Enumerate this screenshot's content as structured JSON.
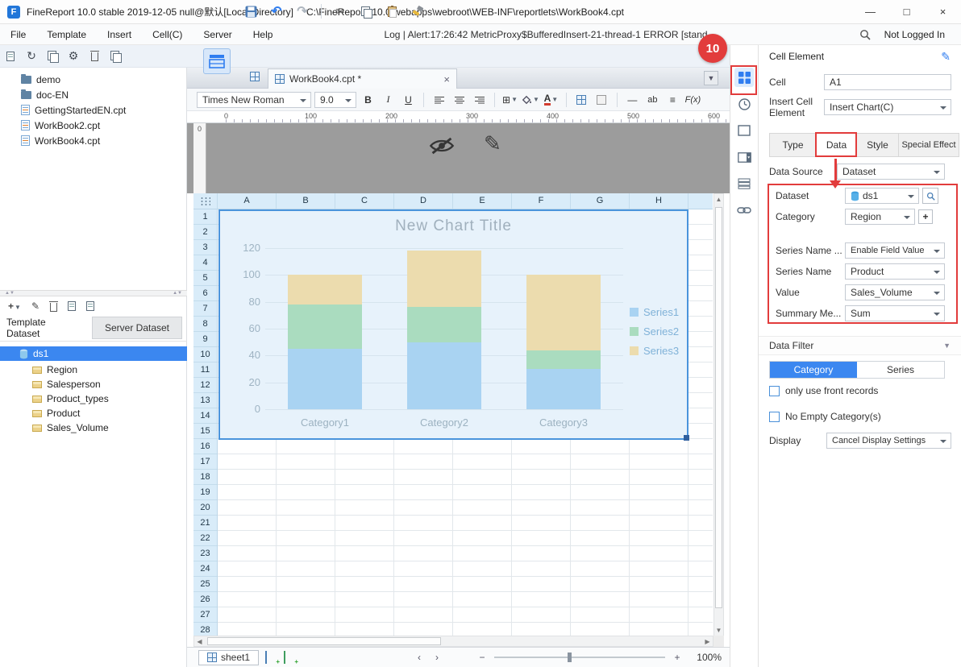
{
  "titlebar": {
    "app_title": "FineReport 10.0 stable 2019-12-05 null@默认[Local Directory]",
    "file_path": "C:\\FineReport_10.0\\webapps\\webroot\\WEB-INF\\reportlets\\WorkBook4.cpt",
    "minimize": "—",
    "maximize": "□",
    "close": "×"
  },
  "menubar": {
    "items": [
      "File",
      "Template",
      "Insert",
      "Cell(C)",
      "Server",
      "Help"
    ],
    "log_text": "Log | Alert:17:26:42 MetricProxy$BufferedInsert-21-thread-1 ERROR [stand",
    "login_label": "Not Logged In"
  },
  "annotations": {
    "badge": "10"
  },
  "sidebar": {
    "folders": [
      "demo",
      "doc-EN"
    ],
    "files": [
      "GettingStartedEN.cpt",
      "WorkBook2.cpt",
      "WorkBook4.cpt"
    ],
    "dataset_tabs": {
      "template": "Template Dataset",
      "server": "Server Dataset"
    },
    "dataset_name": "ds1",
    "fields": [
      "Region",
      "Salesperson",
      "Product_types",
      "Product",
      "Sales_Volume"
    ]
  },
  "document": {
    "tab_label": "WorkBook4.cpt *",
    "font_name": "Times New Roman",
    "font_size": "9.0",
    "bold": "B",
    "italic": "I",
    "underline": "U",
    "fx_label": "F(x)",
    "ab_label": "ab",
    "ruler_marks": [
      "0",
      "100",
      "200",
      "300",
      "400",
      "500",
      "600"
    ],
    "vruler_mark": "0",
    "columns": [
      "A",
      "B",
      "C",
      "D",
      "E",
      "F",
      "G",
      "H"
    ],
    "rows": [
      "1",
      "2",
      "3",
      "4",
      "5",
      "6",
      "7",
      "8",
      "9",
      "10",
      "11",
      "12",
      "13",
      "14",
      "15",
      "16",
      "17",
      "18",
      "19",
      "20",
      "21",
      "22",
      "23",
      "24",
      "25",
      "26",
      "27",
      "28"
    ]
  },
  "chart_data": {
    "type": "bar",
    "stacked": true,
    "title": "New Chart Title",
    "categories": [
      "Category1",
      "Category2",
      "Category3"
    ],
    "series": [
      {
        "name": "Series1",
        "color": "#a9d3f2",
        "values": [
          45,
          50,
          30
        ]
      },
      {
        "name": "Series2",
        "color": "#aadcbf",
        "values": [
          33,
          26,
          14
        ]
      },
      {
        "name": "Series3",
        "color": "#ecdcae",
        "values": [
          22,
          42,
          56
        ]
      }
    ],
    "yticks": [
      0,
      20,
      40,
      60,
      80,
      100,
      120
    ],
    "ylim": [
      0,
      130
    ],
    "xlabel": "",
    "ylabel": "",
    "grid": true,
    "legend_position": "right"
  },
  "statusbar": {
    "sheet_name": "sheet1",
    "zoom_out": "−",
    "zoom_in": "+",
    "zoom_value": "100%",
    "scroll_left": "‹",
    "scroll_right": "›"
  },
  "inspector": {
    "title": "Cell Element",
    "cell_label": "Cell",
    "cell_value": "A1",
    "insert_label": "Insert Cell Element",
    "insert_value": "Insert Chart(C)",
    "tabs": [
      "Type",
      "Data",
      "Style",
      "Special Effect"
    ],
    "active_tab": "Data",
    "data_source_label": "Data Source",
    "data_source_value": "Dataset",
    "binding_rows": [
      {
        "label": "Dataset",
        "value": "ds1"
      },
      {
        "label": "Category",
        "value": "Region"
      },
      {
        "label": "Series Name ...",
        "value": "Enable Field Value"
      },
      {
        "label": "Series Name",
        "value": "Product"
      },
      {
        "label": "Value",
        "value": "Sales_Volume"
      },
      {
        "label": "Summary Me...",
        "value": "Sum"
      }
    ],
    "data_filter_label": "Data Filter",
    "filter_toggle": [
      "Category",
      "Series"
    ],
    "filter_toggle_active": "Category",
    "checkbox_1": "only use front records",
    "checkbox_2": "No Empty Category(s)",
    "display_label": "Display",
    "display_value": "Cancel Display Settings"
  }
}
